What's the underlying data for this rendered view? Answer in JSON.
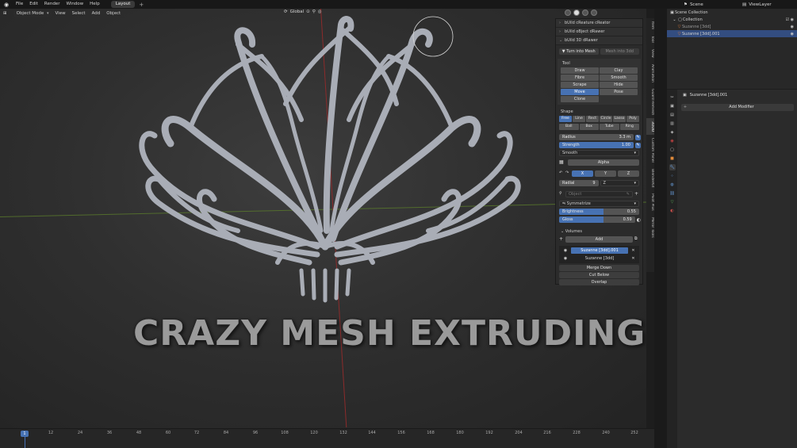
{
  "topbar": {
    "logo_icon": "blender-logo-icon",
    "menus": [
      "File",
      "Edit",
      "Render",
      "Window",
      "Help"
    ],
    "workspace_tab": "Layout",
    "workspace_add": "+",
    "scene_label": "Scene",
    "view_layer_label": "ViewLayer"
  },
  "viewport": {
    "mode": "Object Mode",
    "menus": [
      "View",
      "Select",
      "Add",
      "Object"
    ],
    "orientation": "Global",
    "overlay_text": "CRAZY MESH EXTRUDING"
  },
  "npanel": {
    "sections": {
      "creature": "bUild cReature cReator",
      "object": "bUild oBject dRawer",
      "drawer": "bUild 3D dRawer"
    },
    "turn_into_mesh": "Turn into Mesh",
    "mesh_into_3dd": "Mesh into 3dd",
    "tool_label": "Tool",
    "tools": [
      "Draw",
      "Clay",
      "Fibre",
      "Smooth",
      "Scrape",
      "Hide",
      "Move",
      "Pose",
      "Clone"
    ],
    "active_tool": "Move",
    "shape_label": "Shape",
    "shapes_row1": [
      "Free",
      "Line",
      "Rect",
      "Circle",
      "Lasso",
      "Poly"
    ],
    "shapes_row2": [
      "Ball",
      "Box",
      "Tube",
      "Ring"
    ],
    "active_shape": "Free",
    "radius_label": "Radius",
    "radius_value": "3.3 m",
    "strength_label": "Strength",
    "strength_value": "1.00",
    "smooth_dropdown": "Smooth",
    "alpha_label": "Alpha",
    "axes": [
      "X",
      "Y",
      "Z"
    ],
    "active_axis": "X",
    "radial_label": "Radial",
    "radial_value": "9",
    "radial_axis": "Z",
    "object_placeholder": "Object",
    "symmetrize_label": "Symmetrize",
    "brightness_label": "Brightness",
    "brightness_value": "0.55",
    "gloss_label": "Gloss",
    "gloss_value": "0.59",
    "volumes_label": "Volumes",
    "add_label": "Add",
    "volumes": [
      "Suzanne [3dd].001",
      "Suzanne [3dd]"
    ],
    "merge_down": "Merge Down",
    "cut_below": "Cut Below",
    "overlap": "Overlap"
  },
  "sidetabs": [
    "Item",
    "Tool",
    "View",
    "Animation",
    "Guard Remesh",
    "3DDD",
    "Custom Panel",
    "BlenderKit",
    "Pivot Plus",
    "Mirror Tools"
  ],
  "outliner": {
    "scene_collection": "Scene Collection",
    "collection": "Collection",
    "items": [
      "Suzanne [3dd]",
      "Suzanne [3dd].001"
    ]
  },
  "properties": {
    "object_name": "Suzanne [3dd].001",
    "add_modifier": "Add Modifier"
  },
  "timeline": {
    "current_frame": "1",
    "ticks": [
      "12",
      "24",
      "36",
      "48",
      "60",
      "72",
      "84",
      "96",
      "108",
      "120",
      "132",
      "144",
      "156",
      "168",
      "180",
      "192",
      "204",
      "216",
      "228",
      "240",
      "252"
    ]
  },
  "colors": {
    "accent": "#4772b3",
    "mesh": "#a9adb6"
  }
}
